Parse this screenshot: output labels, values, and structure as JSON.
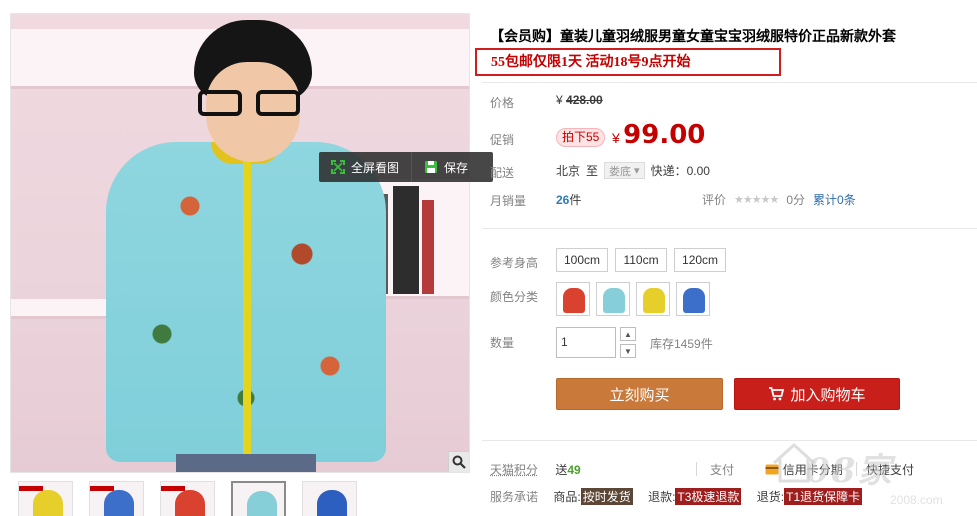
{
  "product": {
    "title": "【会员购】童装儿童羽绒服男童女童宝宝羽绒服特价正品新款外套",
    "promo_line": "55包邮仅限1天 活动18号9点开始"
  },
  "image_overlay": {
    "fullscreen_label": "全屏看图",
    "save_label": "保存"
  },
  "price": {
    "orig_label": "价格",
    "orig_currency": "¥",
    "orig_value": "428.00",
    "promo_label": "促销",
    "promo_tag": "拍下55",
    "currency": "¥",
    "value": "99.00"
  },
  "shipping": {
    "label": "配送",
    "from": "北京",
    "to_word": "至",
    "dest": "娄底",
    "express": "快递：0.00"
  },
  "sales": {
    "label": "月销量",
    "count": "26",
    "unit": "件",
    "rating_label": "评价",
    "stars": "★★★★★",
    "score": "0分",
    "reviews_prefix": "累计",
    "reviews_count": "0",
    "reviews_suffix": "条"
  },
  "options": {
    "size_label": "参考身高",
    "sizes": [
      "100cm",
      "110cm",
      "120cm"
    ],
    "color_label": "颜色分类",
    "colors": [
      "#d8422e",
      "#86cfd8",
      "#e6cf2a",
      "#3c6fc9"
    ]
  },
  "quantity": {
    "label": "数量",
    "value": "1",
    "stock": "库存1459件"
  },
  "buttons": {
    "buy": "立刻购买",
    "cart": "加入购物车"
  },
  "bottom": {
    "points_label": "天猫积分",
    "points_prefix": "送",
    "points_value": "49",
    "pay_label": "支付",
    "credit": "信用卡分期",
    "quick_pay": "快捷支付",
    "promise_label": "服务承诺",
    "goods_prefix": "商品:",
    "goods_tag": "按时发货",
    "return_prefix": "退款:",
    "return_tag": "T3极速退款",
    "return_goods_prefix": "退货:",
    "return_goods_tag": "T1退货保障卡"
  },
  "watermark": {
    "text": "08家",
    "url": "2008.com"
  }
}
